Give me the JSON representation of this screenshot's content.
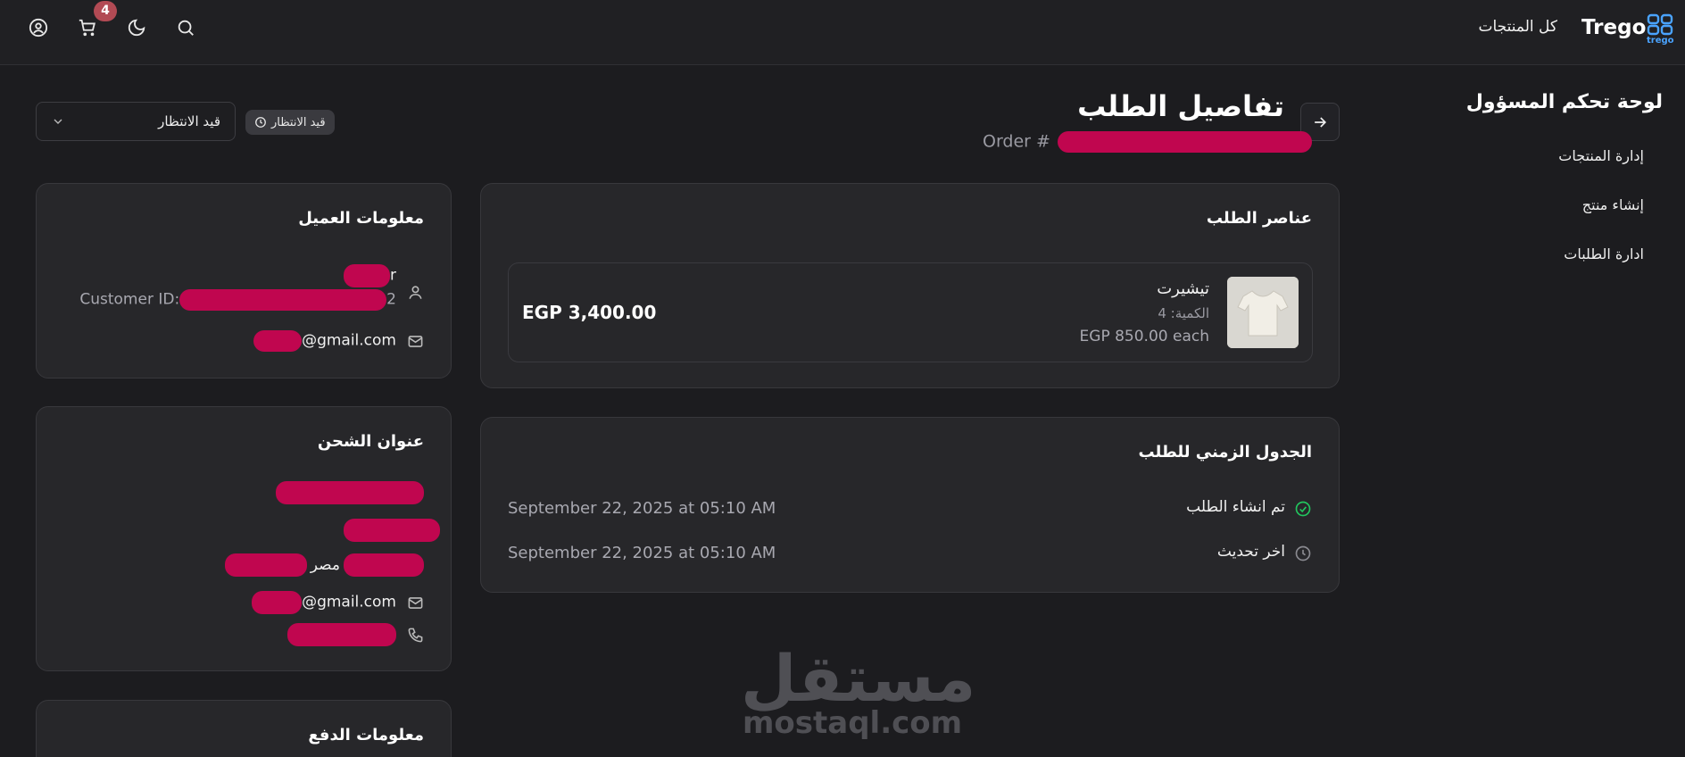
{
  "header": {
    "brand": "Trego",
    "logo_sub": "trego",
    "nav_all_products": "كل المنتجات",
    "cart_count": "4"
  },
  "sidebar": {
    "title": "لوحة تحكم المسؤول",
    "items": [
      {
        "label": "إدارة المنتجات"
      },
      {
        "label": "إنشاء منتج"
      },
      {
        "label": "ادارة الطلبات"
      }
    ]
  },
  "order": {
    "title": "تفاصيل الطلب",
    "number_prefix": "Order #",
    "status_badge": "قيد الانتظار",
    "status_select_value": "قيد الانتظار"
  },
  "items_card": {
    "title": "عناصر الطلب",
    "items": [
      {
        "name": "تيشيرت",
        "qty": "الكمية: 4",
        "each": "EGP 850.00 each",
        "total": "EGP 3,400.00"
      }
    ]
  },
  "timeline": {
    "title": "الجدول الزمني للطلب",
    "rows": [
      {
        "label": "تم انشاء الطلب",
        "date": "September 22, 2025 at 05:10 AM"
      },
      {
        "label": "اخر تحديث",
        "date": "September 22, 2025 at 05:10 AM"
      }
    ]
  },
  "customer": {
    "title": "معلومات العميل",
    "name_tail": "r",
    "customer_id_prefix": "Customer ID:",
    "customer_id_tail": "2",
    "email_tail": "@gmail.com"
  },
  "shipping": {
    "title": "عنوان الشحن",
    "country": "مصر",
    "email_tail": "@gmail.com"
  },
  "payment": {
    "title": "معلومات الدفع"
  },
  "watermark": {
    "arabic": "مستقل",
    "latin": "mostaql.com"
  },
  "colors": {
    "background": "#1c1c1f",
    "card": "#27272a",
    "accent_logo": "#4aa3ff",
    "badge": "#b24a54",
    "redaction": "#c0064f",
    "success": "#22c55e"
  }
}
